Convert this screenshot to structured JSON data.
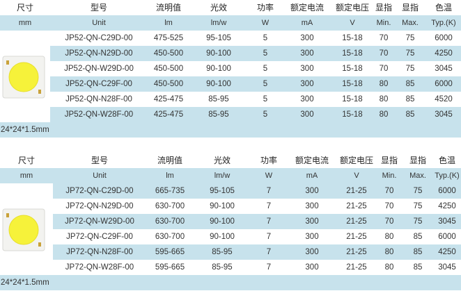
{
  "tables": [
    {
      "headers": [
        "尺寸",
        "型号",
        "流明值",
        "光效",
        "功率",
        "额定电流",
        "额定电压",
        "显指",
        "显指",
        "色温"
      ],
      "units": [
        "mm",
        "Unit",
        "lm",
        "lm/w",
        "W",
        "mA",
        "V",
        "Min.",
        "Max.",
        "Typ.(K)"
      ],
      "rows": [
        [
          "JP52-QN-C29D-00",
          "475-525",
          "95-105",
          "5",
          "300",
          "15-18",
          "70",
          "75",
          "6000"
        ],
        [
          "JP52-QN-N29D-00",
          "450-500",
          "90-100",
          "5",
          "300",
          "15-18",
          "70",
          "75",
          "4250"
        ],
        [
          "JP52-QN-W29D-00",
          "450-500",
          "90-100",
          "5",
          "300",
          "15-18",
          "70",
          "75",
          "3045"
        ],
        [
          "JP52-QN-C29F-00",
          "450-500",
          "90-100",
          "5",
          "300",
          "15-18",
          "80",
          "85",
          "6000"
        ],
        [
          "JP52-QN-N28F-00",
          "425-475",
          "85-95",
          "5",
          "300",
          "15-18",
          "80",
          "85",
          "4520"
        ],
        [
          "JP52-QN-W28F-00",
          "425-475",
          "85-95",
          "5",
          "300",
          "15-18",
          "80",
          "85",
          "3045"
        ]
      ],
      "footer": "24*24*1.5mm"
    },
    {
      "headers": [
        "尺寸",
        "型号",
        "流明值",
        "光效",
        "功率",
        "额定电流",
        "额定电压",
        "显指",
        "显指",
        "色温"
      ],
      "units": [
        "mm",
        "Unit",
        "lm",
        "lm/w",
        "W",
        "mA",
        "V",
        "Min.",
        "Max.",
        "Typ.(K)"
      ],
      "rows": [
        [
          "JP72-QN-C29D-00",
          "665-735",
          "95-105",
          "7",
          "300",
          "21-25",
          "70",
          "75",
          "6000"
        ],
        [
          "JP72-QN-N29D-00",
          "630-700",
          "90-100",
          "7",
          "300",
          "21-25",
          "70",
          "75",
          "4250"
        ],
        [
          "JP72-QN-W29D-00",
          "630-700",
          "90-100",
          "7",
          "300",
          "21-25",
          "70",
          "75",
          "3045"
        ],
        [
          "JP72-QN-C29F-00",
          "630-700",
          "90-100",
          "7",
          "300",
          "21-25",
          "80",
          "85",
          "6000"
        ],
        [
          "JP72-QN-N28F-00",
          "595-665",
          "85-95",
          "7",
          "300",
          "21-25",
          "80",
          "85",
          "4250"
        ],
        [
          "JP72-QN-W28F-00",
          "595-665",
          "85-95",
          "7",
          "300",
          "21-25",
          "80",
          "85",
          "3045"
        ]
      ],
      "footer": "24*24*1.5mm"
    }
  ],
  "colors": {
    "band": "#c7e2ec",
    "chip_board": "#f3f3f0",
    "chip_emitter": "#f6f23a",
    "chip_pad": "#c9a23a"
  },
  "icons": [
    "cob-led-chip-icon"
  ]
}
